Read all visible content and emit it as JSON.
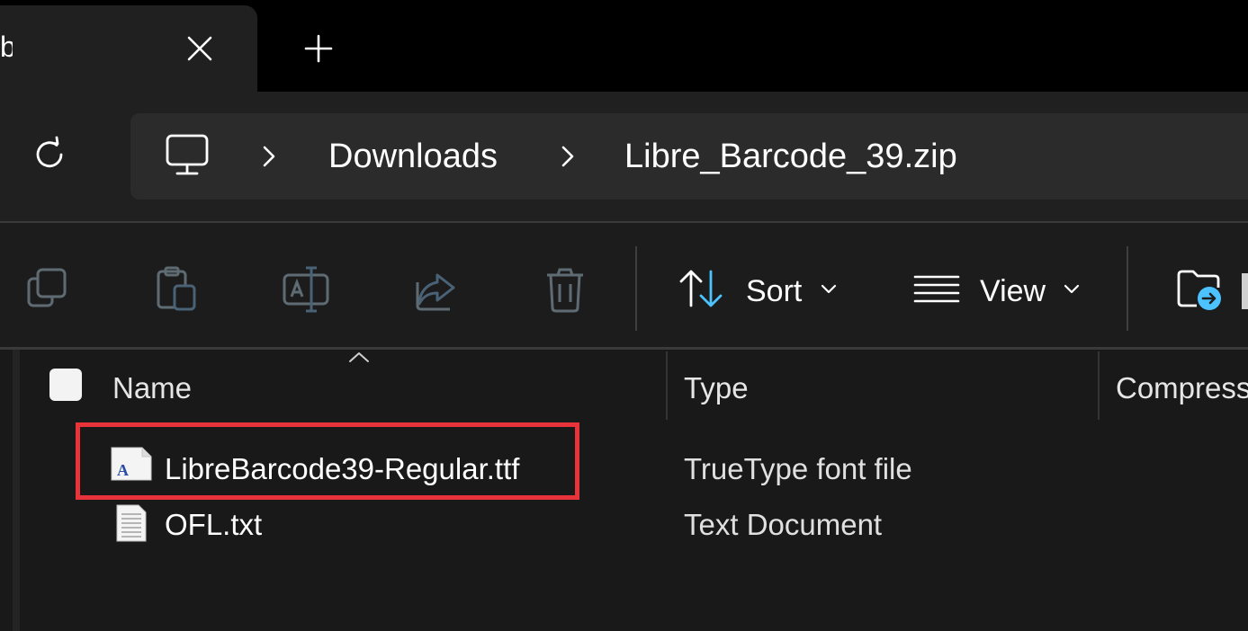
{
  "tabs": {
    "active_title": "b",
    "close_icon": "close-icon",
    "new_tab_icon": "plus-icon"
  },
  "address": {
    "refresh_icon": "refresh-icon",
    "root_icon": "this-pc-icon",
    "crumbs": [
      "Downloads",
      "Libre_Barcode_39.zip"
    ]
  },
  "toolbar": {
    "copy_icon": "copy-icon",
    "paste_icon": "paste-icon",
    "rename_icon": "rename-icon",
    "share_icon": "share-icon",
    "delete_icon": "delete-icon",
    "sort_label": "Sort",
    "view_label": "View",
    "extract_icon": "extract-all-icon"
  },
  "columns": {
    "name": "Name",
    "type": "Type",
    "compressed": "Compress"
  },
  "files": [
    {
      "name": "LibreBarcode39-Regular.ttf",
      "type": "TrueType font file",
      "icon": "font-file-icon"
    },
    {
      "name": "OFL.txt",
      "type": "Text Document",
      "icon": "text-file-icon"
    }
  ],
  "colors": {
    "highlight": "#e8333b",
    "accent": "#4cc2ff"
  }
}
